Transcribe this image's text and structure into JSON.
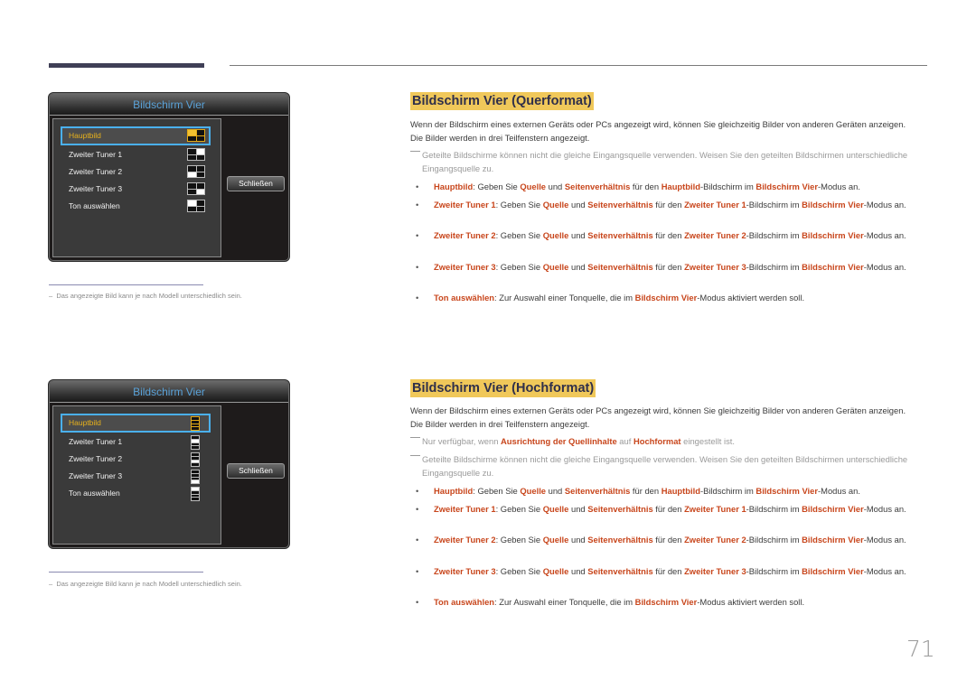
{
  "page_number": "71",
  "colors": {
    "highlight": "#c8461c",
    "title_bg": "#f0c85a",
    "osd_title": "#5aa2d8",
    "osd_selected": "#e8b11c",
    "osd_focus_border": "#4ab0ee"
  },
  "osd_landscape": {
    "title": "Bildschirm Vier",
    "items": [
      {
        "label": "Hauptbild",
        "selected": true,
        "icon": "quad-top-left-icon"
      },
      {
        "label": "Zweiter Tuner 1",
        "selected": false,
        "icon": "quad-top-right-icon"
      },
      {
        "label": "Zweiter Tuner 2",
        "selected": false,
        "icon": "quad-bottom-left-icon"
      },
      {
        "label": "Zweiter Tuner 3",
        "selected": false,
        "icon": "quad-bottom-right-icon"
      },
      {
        "label": "Ton auswählen",
        "selected": false,
        "icon": "quad-top-left-icon"
      }
    ],
    "close_label": "Schließen"
  },
  "osd_portrait": {
    "title": "Bildschirm Vier",
    "items": [
      {
        "label": "Hauptbild",
        "selected": true,
        "icon": "stack-first-icon"
      },
      {
        "label": "Zweiter Tuner 1",
        "selected": false,
        "icon": "stack-second-icon"
      },
      {
        "label": "Zweiter Tuner 2",
        "selected": false,
        "icon": "stack-third-icon"
      },
      {
        "label": "Zweiter Tuner 3",
        "selected": false,
        "icon": "stack-fourth-icon"
      },
      {
        "label": "Ton auswählen",
        "selected": false,
        "icon": "stack-first-icon"
      }
    ],
    "close_label": "Schließen"
  },
  "footnote": "Das angezeigte Bild kann je nach Modell unterschiedlich sein.",
  "footnote_dash": "–",
  "section_landscape": {
    "title": "Bildschirm Vier (Querformat)",
    "intro": "Wenn der Bildschirm eines externen Geräts oder PCs angezeigt wird, können Sie gleichzeitig Bilder von anderen Geräten anzeigen. Die Bilder werden in drei Teilfenstern angezeigt.",
    "note1": "Geteilte Bildschirme können nicht die gleiche Eingangsquelle verwenden. Weisen Sie den geteilten Bildschirmen unterschiedliche Eingangsquelle zu.",
    "bullets": [
      {
        "term": "Hauptbild",
        "t1": ": Geben Sie ",
        "b1": "Quelle",
        "t2": " und ",
        "b2": "Seitenverhältnis",
        "t3": " für den ",
        "b3": "Hauptbild",
        "t4": "-Bildschirm im ",
        "b4": "Bildschirm Vier",
        "t5": "-Modus an."
      },
      {
        "term": "Zweiter Tuner 1",
        "t1": ": Geben Sie ",
        "b1": "Quelle",
        "t2": " und ",
        "b2": "Seitenverhältnis",
        "t3": " für den ",
        "b3": "Zweiter Tuner 1",
        "t4": "-Bildschirm im ",
        "b4": "Bildschirm Vier",
        "t5": "-Modus an."
      },
      {
        "term": "Zweiter Tuner 2",
        "t1": ": Geben Sie ",
        "b1": "Quelle",
        "t2": " und ",
        "b2": "Seitenverhältnis",
        "t3": " für den ",
        "b3": "Zweiter Tuner 2",
        "t4": "-Bildschirm im ",
        "b4": "Bildschirm Vier",
        "t5": "-Modus an."
      },
      {
        "term": "Zweiter Tuner 3",
        "t1": ": Geben Sie ",
        "b1": "Quelle",
        "t2": " und ",
        "b2": "Seitenverhältnis",
        "t3": " für den ",
        "b3": "Zweiter Tuner 3",
        "t4": "-Bildschirm im ",
        "b4": "Bildschirm Vier",
        "t5": "-Modus an."
      }
    ],
    "ton": {
      "term": "Ton auswählen",
      "t1": ": Zur Auswahl einer Tonquelle, die im ",
      "b1": "Bildschirm Vier",
      "t2": "-Modus aktiviert werden soll."
    }
  },
  "section_portrait": {
    "title": "Bildschirm Vier (Hochformat)",
    "intro": "Wenn der Bildschirm eines externen Geräts oder PCs angezeigt wird, können Sie gleichzeitig Bilder von anderen Geräten anzeigen. Die Bilder werden in drei Teilfenstern angezeigt.",
    "note0": {
      "t1": "Nur verfügbar, wenn ",
      "b1": "Ausrichtung der Quellinhalte",
      "t2": " auf ",
      "b2": "Hochformat",
      "t3": " eingestellt ist."
    },
    "note1": "Geteilte Bildschirme können nicht die gleiche Eingangsquelle verwenden. Weisen Sie den geteilten Bildschirmen unterschiedliche Eingangsquelle zu.",
    "bullets": [
      {
        "term": "Hauptbild",
        "t1": ": Geben Sie ",
        "b1": "Quelle",
        "t2": " und ",
        "b2": "Seitenverhältnis",
        "t3": " für den ",
        "b3": "Hauptbild",
        "t4": "-Bildschirm im ",
        "b4": "Bildschirm Vier",
        "t5": "-Modus an."
      },
      {
        "term": "Zweiter Tuner 1",
        "t1": ": Geben Sie ",
        "b1": "Quelle",
        "t2": " und ",
        "b2": "Seitenverhältnis",
        "t3": " für den ",
        "b3": "Zweiter Tuner 1",
        "t4": "-Bildschirm im ",
        "b4": "Bildschirm Vier",
        "t5": "-Modus an."
      },
      {
        "term": "Zweiter Tuner 2",
        "t1": ": Geben Sie ",
        "b1": "Quelle",
        "t2": " und ",
        "b2": "Seitenverhältnis",
        "t3": " für den ",
        "b3": "Zweiter Tuner 2",
        "t4": "-Bildschirm im ",
        "b4": "Bildschirm Vier",
        "t5": "-Modus an."
      },
      {
        "term": "Zweiter Tuner 3",
        "t1": ": Geben Sie ",
        "b1": "Quelle",
        "t2": " und ",
        "b2": "Seitenverhältnis",
        "t3": " für den ",
        "b3": "Zweiter Tuner 3",
        "t4": "-Bildschirm im ",
        "b4": "Bildschirm Vier",
        "t5": "-Modus an."
      }
    ],
    "ton": {
      "term": "Ton auswählen",
      "t1": ": Zur Auswahl einer Tonquelle, die im ",
      "b1": "Bildschirm Vier",
      "t2": "-Modus aktiviert werden soll."
    }
  }
}
